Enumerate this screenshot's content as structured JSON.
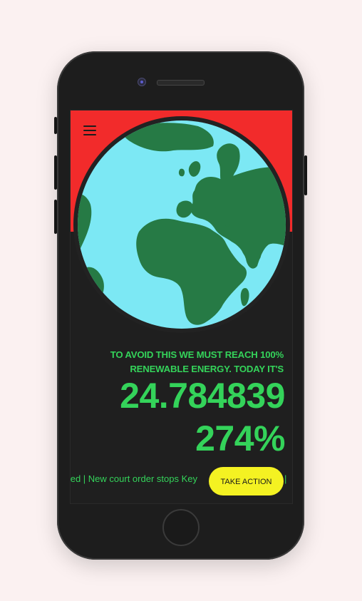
{
  "header": {
    "menu_icon": "hamburger-icon"
  },
  "hero": {
    "image": "earth-globe",
    "bg_color": "#f22b2b",
    "ocean_color": "#7ce8f4",
    "land_color": "#267a45"
  },
  "headline": {
    "line1": "TO AVOID THIS WE MUST REACH 100%",
    "line2": "RENEWABLE ENERGY. TODAY IT'S"
  },
  "counter": {
    "value": "24.784839",
    "percent": "274%"
  },
  "ticker": {
    "text": "osed | New court order stops Key",
    "tail": "|"
  },
  "cta": {
    "label": "TAKE ACTION",
    "color": "#f4f222"
  },
  "theme": {
    "accent": "#34d35a",
    "background": "#1f1f1f"
  }
}
